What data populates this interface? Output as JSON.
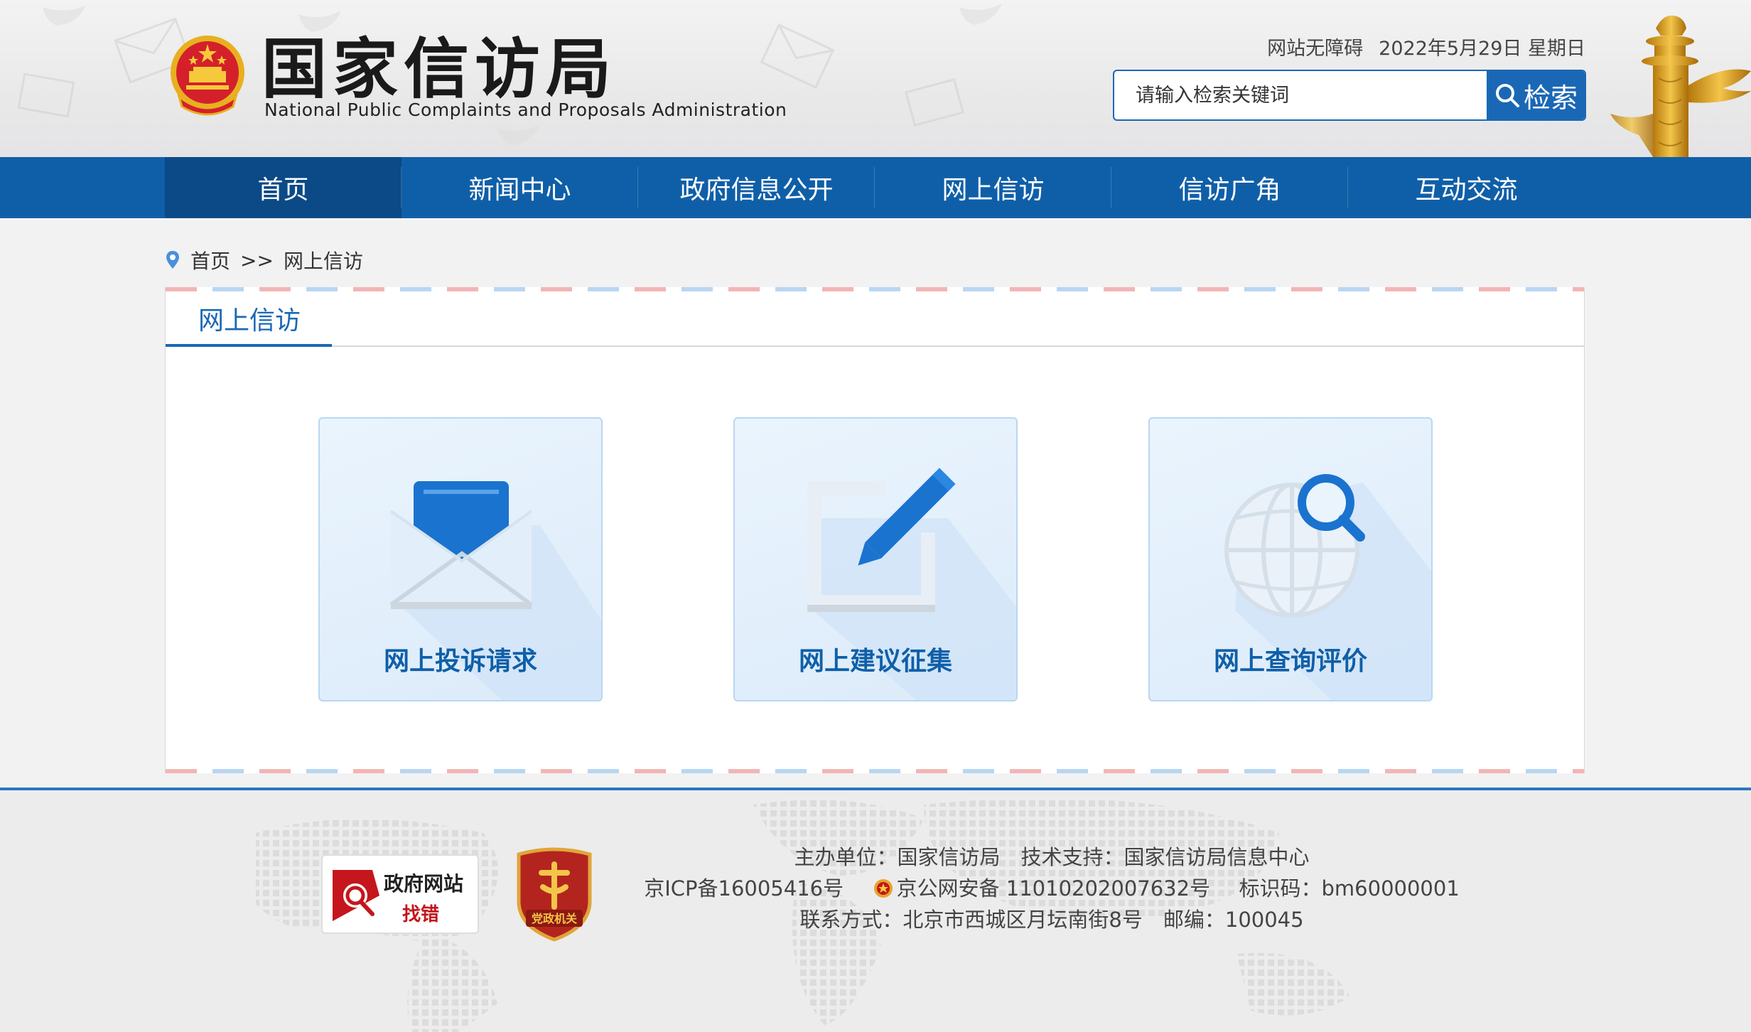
{
  "header": {
    "site_title_cn": "国家信访局",
    "site_title_en": "National Public Complaints and Proposals Administration",
    "accessibility_link": "网站无障碍",
    "date_text": "2022年5月29日 星期日",
    "search_placeholder": "请输入检索关键词",
    "search_button": "检索"
  },
  "nav": {
    "items": [
      {
        "label": "首页"
      },
      {
        "label": "新闻中心"
      },
      {
        "label": "政府信息公开"
      },
      {
        "label": "网上信访"
      },
      {
        "label": "信访广角"
      },
      {
        "label": "互动交流"
      }
    ]
  },
  "breadcrumb": {
    "home": "首页",
    "separator": ">>",
    "current": "网上信访"
  },
  "panel": {
    "tab_title": "网上信访",
    "cards": [
      {
        "label": "网上投诉请求",
        "icon": "envelope-icon"
      },
      {
        "label": "网上建议征集",
        "icon": "pencil-edit-icon"
      },
      {
        "label": "网上查询评价",
        "icon": "globe-search-icon"
      }
    ]
  },
  "footer": {
    "badge_gov_line1": "政府网站",
    "badge_gov_line2": "找错",
    "badge_party_label": "党政机关",
    "line1": "主办单位：国家信访局　技术支持：国家信访局信息中心",
    "icp": "京ICP备16005416号",
    "police": "京公网安备 11010202007632号",
    "code": "标识码：bm60000001",
    "line3": "联系方式：北京市西城区月坛南街8号　邮编：100045"
  },
  "colors": {
    "nav_bg": "#0f5fa8",
    "nav_active": "#0b4a86",
    "accent": "#1a68b5"
  }
}
